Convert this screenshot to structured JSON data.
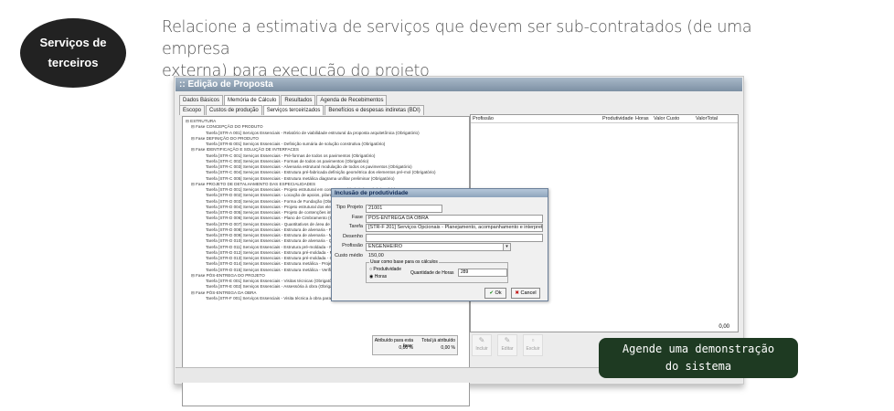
{
  "badge": {
    "line1": "Serviços de",
    "line2": "terceiros"
  },
  "headline": {
    "line1": "Relacione a estimativa de serviços que devem ser sub-contratados (de uma empresa",
    "line2": "externa) para execução do projeto"
  },
  "app": {
    "title": ":: Edição de Proposta",
    "tabs1": [
      "Dados Básicos",
      "Memória de Cálculo",
      "Resultados",
      "Agenda de Recebimentos"
    ],
    "tabs2": [
      "Escopo",
      "Custos de produção",
      "Serviços terceirizados",
      "Benefícios e despesas indiretas (BDI)"
    ],
    "tree": [
      {
        "level": 0,
        "text": "⊟ ESTRUTURA"
      },
      {
        "level": 1,
        "text": "⊟ Fase CONCEPÇÃO DO PRODUTO"
      },
      {
        "level": 2,
        "text": "Tarefa [STR-A 001] Serviços Essenciais - Relatório de viabilidade estrutural da proposta arquitetônica (Obrigatório)"
      },
      {
        "level": 1,
        "text": "⊟ Fase DEFINIÇÃO DO PRODUTO"
      },
      {
        "level": 2,
        "text": "Tarefa [STR-B 001] Serviços Essenciais - Definição sumária de solução construtiva (Obrigatório)"
      },
      {
        "level": 1,
        "text": "⊟ Fase IDENTIFICAÇÃO E SOLUÇÃO DE INTERFACES"
      },
      {
        "level": 2,
        "text": "Tarefa [STR-C 001] Serviços Essenciais - Pré-formas de todos os pavimentos (Obrigatório)"
      },
      {
        "level": 2,
        "text": "Tarefa [STR-C 002] Serviços Essenciais - Formas de todos os pavimentos (Obrigatório)"
      },
      {
        "level": 2,
        "text": "Tarefa [STR-C 003] Serviços Essenciais - Alvenaria estrutural modulação de todos os pavimentos (Obrigatório)"
      },
      {
        "level": 2,
        "text": "Tarefa [STR-C 004] Serviços Essenciais - Estrutura pré-fabricada definição geométrica dos elementos pré-mol (Obrigatório)"
      },
      {
        "level": 2,
        "text": "Tarefa [STR-C 005] Serviços Essenciais - Estrutura metálica diagrama unifilar preliminar (Obrigatório)"
      },
      {
        "level": 1,
        "text": "⊟ Fase PROJETO DE DETALHAMENTO DAS ESPECIALIDADES"
      },
      {
        "level": 2,
        "text": "Tarefa [STR-D 001] Serviços Essenciais - Projeto estrutural em concreto moldado in loco (Obrigatório)"
      },
      {
        "level": 2,
        "text": "Tarefa [STR-D 002] Serviços Essenciais - Locação de apoios, pilares e..."
      },
      {
        "level": 2,
        "text": "Tarefa [STR-D 003] Serviços Essenciais - Forma de Fundação (Obrigatório)"
      },
      {
        "level": 2,
        "text": "Tarefa [STR-D 004] Serviços Essenciais - Projeto estrutural dos elem..."
      },
      {
        "level": 2,
        "text": "Tarefa [STR-D 005] Serviços Essenciais - Projeto de contenções interna..."
      },
      {
        "level": 2,
        "text": "Tarefa [STR-D 006] Serviços Essenciais - Plano de Cimbramento (Obrig..."
      },
      {
        "level": 2,
        "text": "Tarefa [STR-D 007] Serviços Essenciais - Quantitativos de área de form..."
      },
      {
        "level": 2,
        "text": "Tarefa [STR-D 008] Serviços Essenciais - Estrutura de alvenaria - Proje..."
      },
      {
        "level": 2,
        "text": "Tarefa [STR-D 009] Serviços Essenciais - Estrutura de alvenaria - Memo..."
      },
      {
        "level": 2,
        "text": "Tarefa [STR-D 010] Serviços Essenciais - Estrutura de alvenaria - Quan..."
      },
      {
        "level": 2,
        "text": "Tarefa [STR-D 011] Serviços Essenciais - Estrutura pré-moldada - Proje..."
      },
      {
        "level": 2,
        "text": "Tarefa [STR-D 012] Serviços Essenciais - Estrutura pré-moldada - Memo..."
      },
      {
        "level": 2,
        "text": "Tarefa [STR-D 013] Serviços Essenciais - Estrutura pré-moldada - Quan..."
      },
      {
        "level": 2,
        "text": "Tarefa [STR-D 014] Serviços Essenciais - Estrutura metálica - Projeto u..."
      },
      {
        "level": 2,
        "text": "Tarefa [STR-D 015] Serviços Essenciais - Estrutura metálica - Verificaç..."
      },
      {
        "level": 1,
        "text": "⊟ Fase PÓS-ENTREGA DO PROJETO"
      },
      {
        "level": 2,
        "text": "Tarefa [STR-E 001] Serviços Essenciais - Visitas técnicas (Obrigatório)"
      },
      {
        "level": 2,
        "text": "Tarefa [STR-E 002] Serviços Essenciais - Assessória à obra (Obrigatóri..."
      },
      {
        "level": 1,
        "text": "⊟ Fase PÓS-ENTREGA DA OBRA"
      },
      {
        "level": 2,
        "text": "Tarefa [STR-F 001] Serviços Essenciais - Visita técnica à obra para ava..."
      }
    ],
    "left_footer": {
      "label1": "Atribuído para esta fase:",
      "value1": "0,00 %",
      "label2": "Total já atribuído",
      "value2": "0,00 %"
    },
    "right_columns": [
      "Profissão",
      "Produtividade",
      "Horas",
      "Valor Custo",
      "ValorTotal"
    ],
    "right_total": "0,00",
    "right_buttons": [
      "Incluir",
      "Editar",
      "Excluir"
    ]
  },
  "dialog": {
    "title": "Inclusão de produtividade",
    "tipo_label": "Tipo Projeto",
    "tipo_value": "21001",
    "fase_label": "Fase",
    "fase_value": "PÓS-ENTREGA DA OBRA",
    "tarefa_label": "Tarefa",
    "tarefa_value": "[STR-F 201] Serviços Opcionais - Planejamento, acompanhamento e interpretação di",
    "desenho_label": "Desenho",
    "desenho_value": "",
    "profissao_label": "Profissão",
    "profissao_value": "ENGENHEIRO",
    "custo_label": "Custo médio",
    "custo_value": "150,00",
    "group_label": "Usar como base para os cálculos",
    "radio1": "Produtividade",
    "radio2": "Horas",
    "horas_label": "Quantidade de Horas",
    "horas_value": "289",
    "ok": "Ok",
    "cancel": "Cancel"
  },
  "cta": {
    "line1": "Agende uma demonstração",
    "line2": "do sistema"
  }
}
